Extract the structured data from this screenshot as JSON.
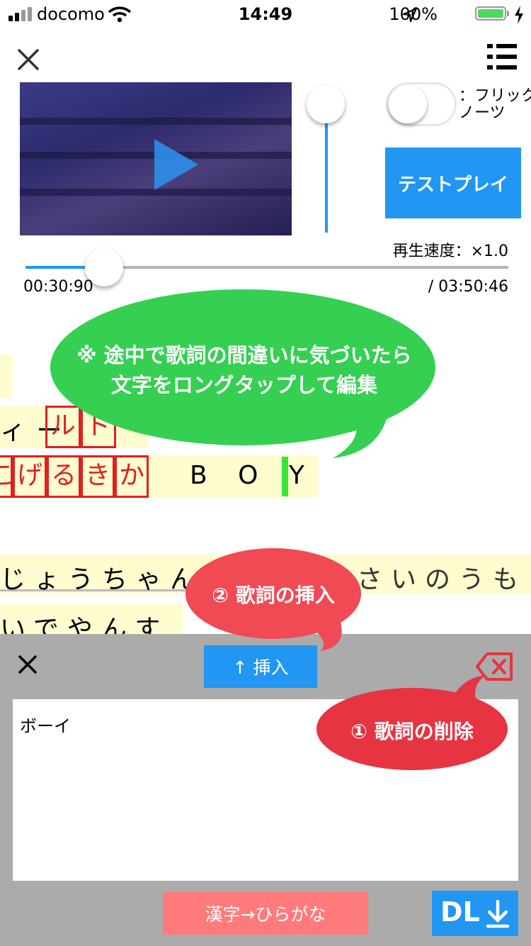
{
  "status": {
    "carrier": "docomo",
    "time": "14:49",
    "battery": "100%"
  },
  "header": {
    "close_icon": "close-icon",
    "menu_icon": "list-icon"
  },
  "flick": {
    "label": "：フリック\nノーツ",
    "enabled": false
  },
  "test_play": {
    "label": "テストプレイ",
    "color": "#2196f3"
  },
  "playback": {
    "speed_label": "再生速度：×1.0",
    "current": "00:30:90",
    "total": "/ 03:50:46",
    "progress": 0.1339
  },
  "tip_green": {
    "line1": "※ 途中で歌詞の間違いに気づいたら",
    "line2": "文字をロングタップして編集",
    "color": "#35d052"
  },
  "lyrics": {
    "line1_part": "ィ ー",
    "line1_boxes": [
      "ル",
      "ド"
    ],
    "line2_boxes": [
      "こ",
      "げ",
      "る",
      "き",
      "か"
    ],
    "line2_tail": "B O Y",
    "line3a": "じょうちゃん",
    "line3b": "おかねもさいのうも",
    "line4": "いでやんす"
  },
  "tip_insert": {
    "label": "② 歌詞の挿入",
    "color": "#f04a55"
  },
  "tip_delete": {
    "label": "① 歌詞の削除",
    "color": "#e63442"
  },
  "editor": {
    "close_icon": "close-icon",
    "insert_label": "↑ 挿入",
    "backspace_icon": "backspace-icon",
    "text_value": "ボーイ",
    "convert_label": "漢字→ひらがな",
    "dl_label": "DL"
  }
}
